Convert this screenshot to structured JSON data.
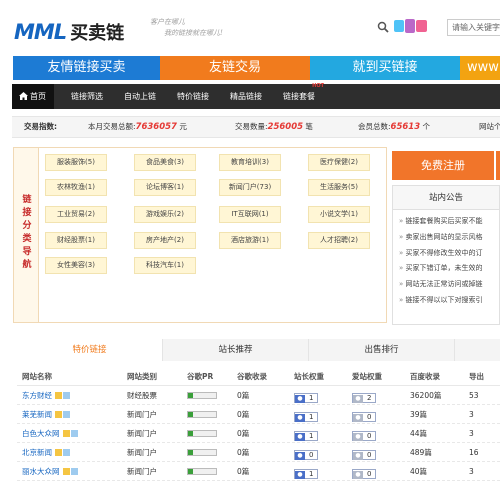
{
  "header": {
    "logo_mark": "MML",
    "logo_text": "买卖链",
    "slogan_line1": "客户在哪儿",
    "slogan_line2": "我的链接就在哪儿!",
    "search_placeholder": "请输入关键字"
  },
  "banners": [
    {
      "label": "友情链接买卖",
      "color": "#1d7bd4"
    },
    {
      "label": "友链交易",
      "color": "#f17b1d"
    },
    {
      "label": "就到买链接",
      "color": "#23a8e0"
    },
    {
      "label": "www",
      "color": "#f3a311"
    }
  ],
  "nav": {
    "items": [
      "首页",
      "链接筛选",
      "自动上链",
      "特价链接",
      "精品链接",
      "链接套餐"
    ],
    "hot_badge": "HOT"
  },
  "stats": {
    "label": "交易指数:",
    "monthly_label": "本月交易总额:",
    "monthly_value": "7636057",
    "monthly_unit": "元",
    "count_label": "交易数量:",
    "count_value": "256005",
    "count_unit": "笔",
    "members_label": "会员总数:",
    "members_value": "65613",
    "members_unit": "个",
    "more_label": "网站个"
  },
  "categories": {
    "side_title": "链接分类导航",
    "tags": [
      "服装服饰(5)",
      "食品美食(3)",
      "教育培训(3)",
      "医疗保健(2)",
      "农林牧渔(1)",
      "论坛博客(1)",
      "新闻门户(73)",
      "生活服务(5)",
      "工业贸易(2)",
      "游戏娱乐(2)",
      "IT互联网(1)",
      "小说文学(1)",
      "财经股票(1)",
      "房产地产(2)",
      "酒店旅游(1)",
      "人才招聘(2)",
      "女性美容(3)",
      "科技汽车(1)"
    ]
  },
  "sidebar": {
    "register_label": "免费注册",
    "notice_title": "站内公告",
    "notices": [
      "链接套餐购买后买家不能",
      "卖家出售网站的显示风格",
      "买家不得修改生效中的订",
      "买家下错订单，未生效的",
      "网站无法正常访问或掉链",
      "链接不得以以下对搜索引"
    ]
  },
  "tabs": [
    "特价链接",
    "站长推荐",
    "出售排行"
  ],
  "table": {
    "headers": [
      "网站名称",
      "网站类别",
      "谷歌PR",
      "谷歌收录",
      "站长权重",
      "爱站权重",
      "百度收录",
      "导出"
    ],
    "rows": [
      {
        "name": "东方财经",
        "category": "财经股票",
        "pr": "0",
        "google": "0篇",
        "zz": "1",
        "aizhan": "2",
        "baidu": "36200篇",
        "out": "53"
      },
      {
        "name": "莱芜新闻",
        "category": "新闻门户",
        "pr": "0",
        "google": "0篇",
        "zz": "1",
        "aizhan": "0",
        "baidu": "39篇",
        "out": "3"
      },
      {
        "name": "白色大众网",
        "category": "新闻门户",
        "pr": "0",
        "google": "0篇",
        "zz": "1",
        "aizhan": "0",
        "baidu": "44篇",
        "out": "3"
      },
      {
        "name": "北京新闻",
        "category": "新闻门户",
        "pr": "0",
        "google": "0篇",
        "zz": "0",
        "aizhan": "0",
        "baidu": "489篇",
        "out": "16"
      },
      {
        "name": "丽水大众网",
        "category": "新闻门户",
        "pr": "0",
        "google": "0篇",
        "zz": "1",
        "aizhan": "0",
        "baidu": "40篇",
        "out": "3"
      }
    ]
  },
  "colors": {
    "accent_orange": "#f17b1d",
    "accent_blue": "#1d7bd4",
    "price_red": "#e53935"
  }
}
